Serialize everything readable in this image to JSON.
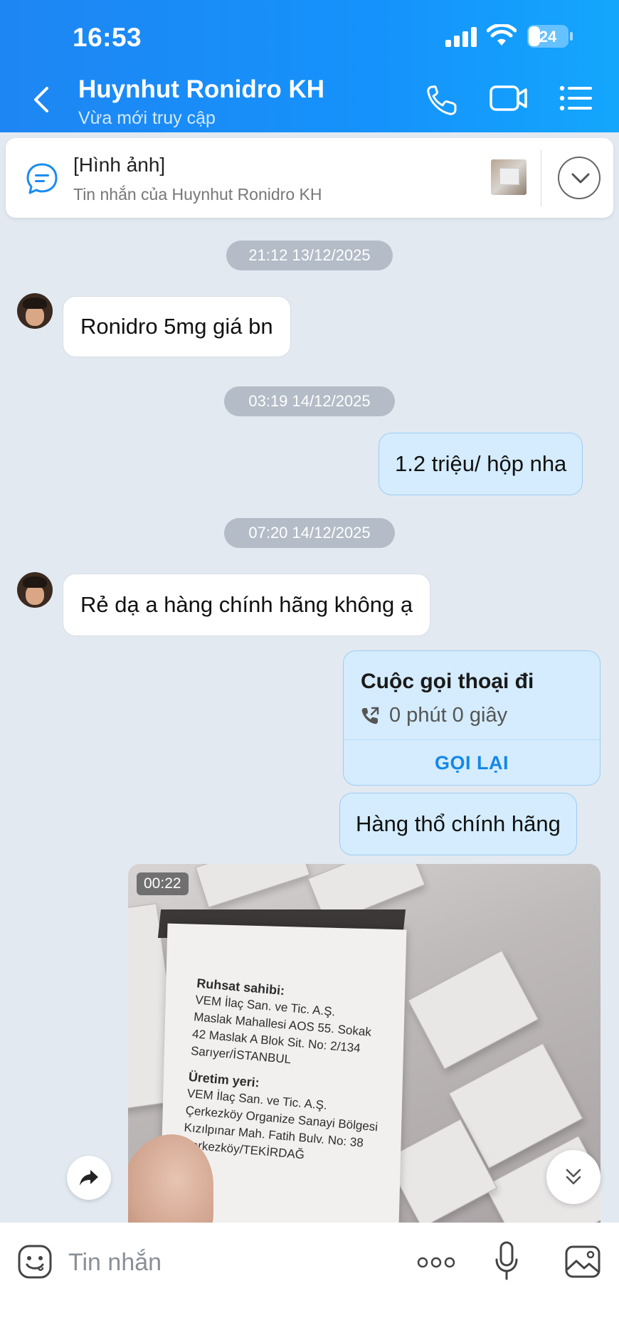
{
  "status_bar": {
    "time": "16:53",
    "battery": "24",
    "icons": [
      "signal-icon",
      "wifi-icon",
      "battery-icon"
    ]
  },
  "header": {
    "title": "Huynhut Ronidro KH",
    "subtitle": "Vừa mới truy cập",
    "icons": [
      "back-icon",
      "phone-icon",
      "video-call-icon",
      "menu-icon"
    ],
    "accent_color": "#1e86f3"
  },
  "pinned": {
    "title": "[Hình ảnh]",
    "subtitle": "Tin nhắn của Huynhut Ronidro KH",
    "icon": "chat-bubble-icon"
  },
  "messages": {
    "date1": "21:12 13/12/2025",
    "m1": "Ronidro 5mg giá bn",
    "date2": "03:19 14/12/2025",
    "m2": "1.2 triệu/ hộp nha",
    "date3": "07:20 14/12/2025",
    "m3": "Rẻ dạ a hàng chính hãng không ạ",
    "call": {
      "title": "Cuộc gọi thoại đi",
      "duration": "0 phút 0 giây",
      "callback": "GỌI LẠI"
    },
    "m4": "Hàng thổ chính hãng",
    "video": {
      "duration": "00:22"
    }
  },
  "input": {
    "placeholder": "Tin nhắn",
    "icons": [
      "emoji-icon",
      "more-icon",
      "microphone-icon",
      "gallery-icon"
    ]
  },
  "colors": {
    "incoming_bubble": "#ffffff",
    "outgoing_bubble": "#d4ecfd",
    "chat_background": "#e2e9f1",
    "link_blue": "#1487e8"
  }
}
